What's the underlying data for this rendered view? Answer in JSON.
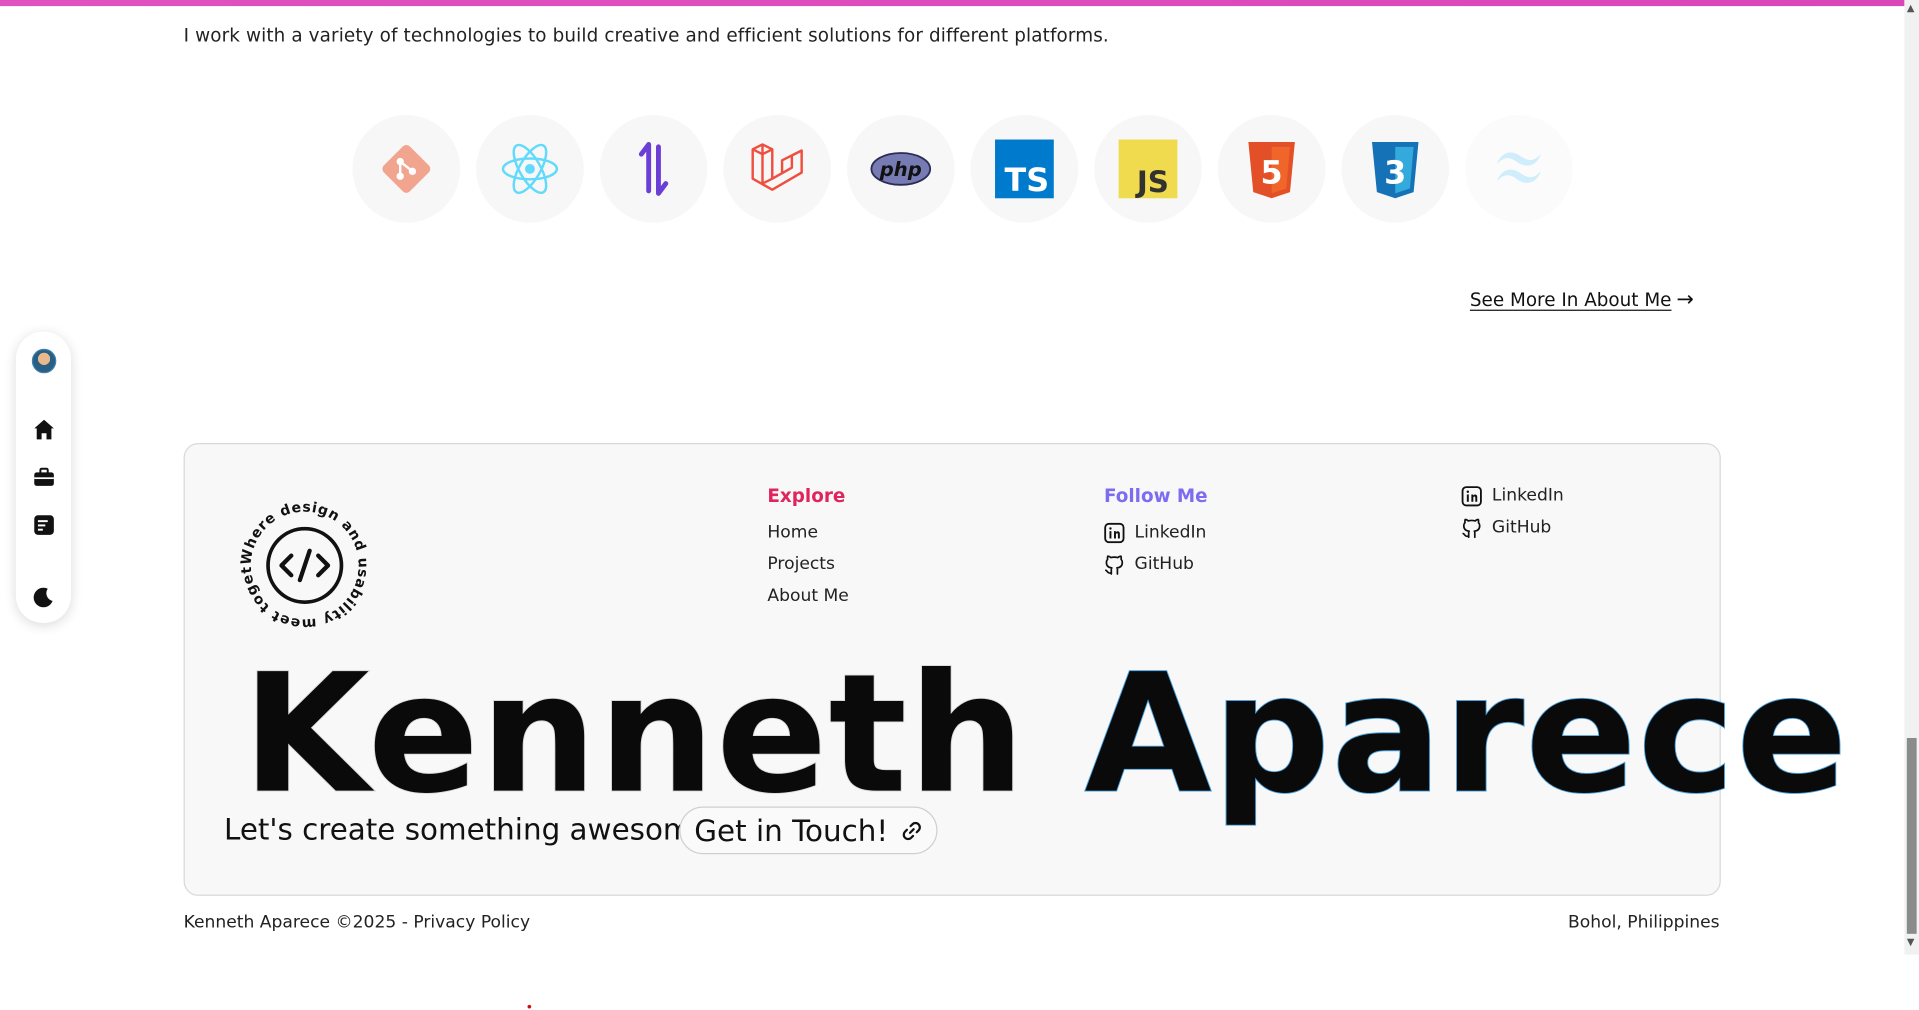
{
  "intro_text": "I work with a variety of technologies to build creative and efficient solutions for different platforms.",
  "tech_icons": [
    "git-icon",
    "react-icon",
    "inertia-icon",
    "laravel-icon",
    "php-icon",
    "typescript-icon",
    "javascript-icon",
    "html5-icon",
    "css3-icon",
    "tailwind-icon"
  ],
  "icon_text": {
    "php": "php",
    "ts": "TS",
    "js": "JS",
    "html": "5",
    "css": "3"
  },
  "see_more": {
    "label": "See More In About Me",
    "arrow": "→"
  },
  "badge_text": "Where design and usability meet together.",
  "explore": {
    "heading": "Explore",
    "links": [
      "Home",
      "Projects",
      "About Me"
    ]
  },
  "follow": {
    "heading": "Follow Me",
    "links": [
      {
        "label": "LinkedIn",
        "icon": "linkedin-icon"
      },
      {
        "label": "GitHub",
        "icon": "github-icon"
      }
    ]
  },
  "social_extra": [
    {
      "label": "LinkedIn",
      "icon": "linkedin-icon"
    },
    {
      "label": "GitHub",
      "icon": "github-icon"
    }
  ],
  "big_name": {
    "first": "Kenneth",
    "last": "Aparece"
  },
  "cta": {
    "text": "Let's create something awesome",
    "button": "Get in Touch!"
  },
  "footer": {
    "copyright": "Kenneth Aparece ©2025 - Privacy Policy",
    "location": "Bohol, Philippines"
  },
  "colors": {
    "accent_pink": "#e0245e",
    "accent_purple": "#7c6cf0",
    "top_bar": "#e052c0",
    "outline_blue": "#4aa3e0"
  }
}
